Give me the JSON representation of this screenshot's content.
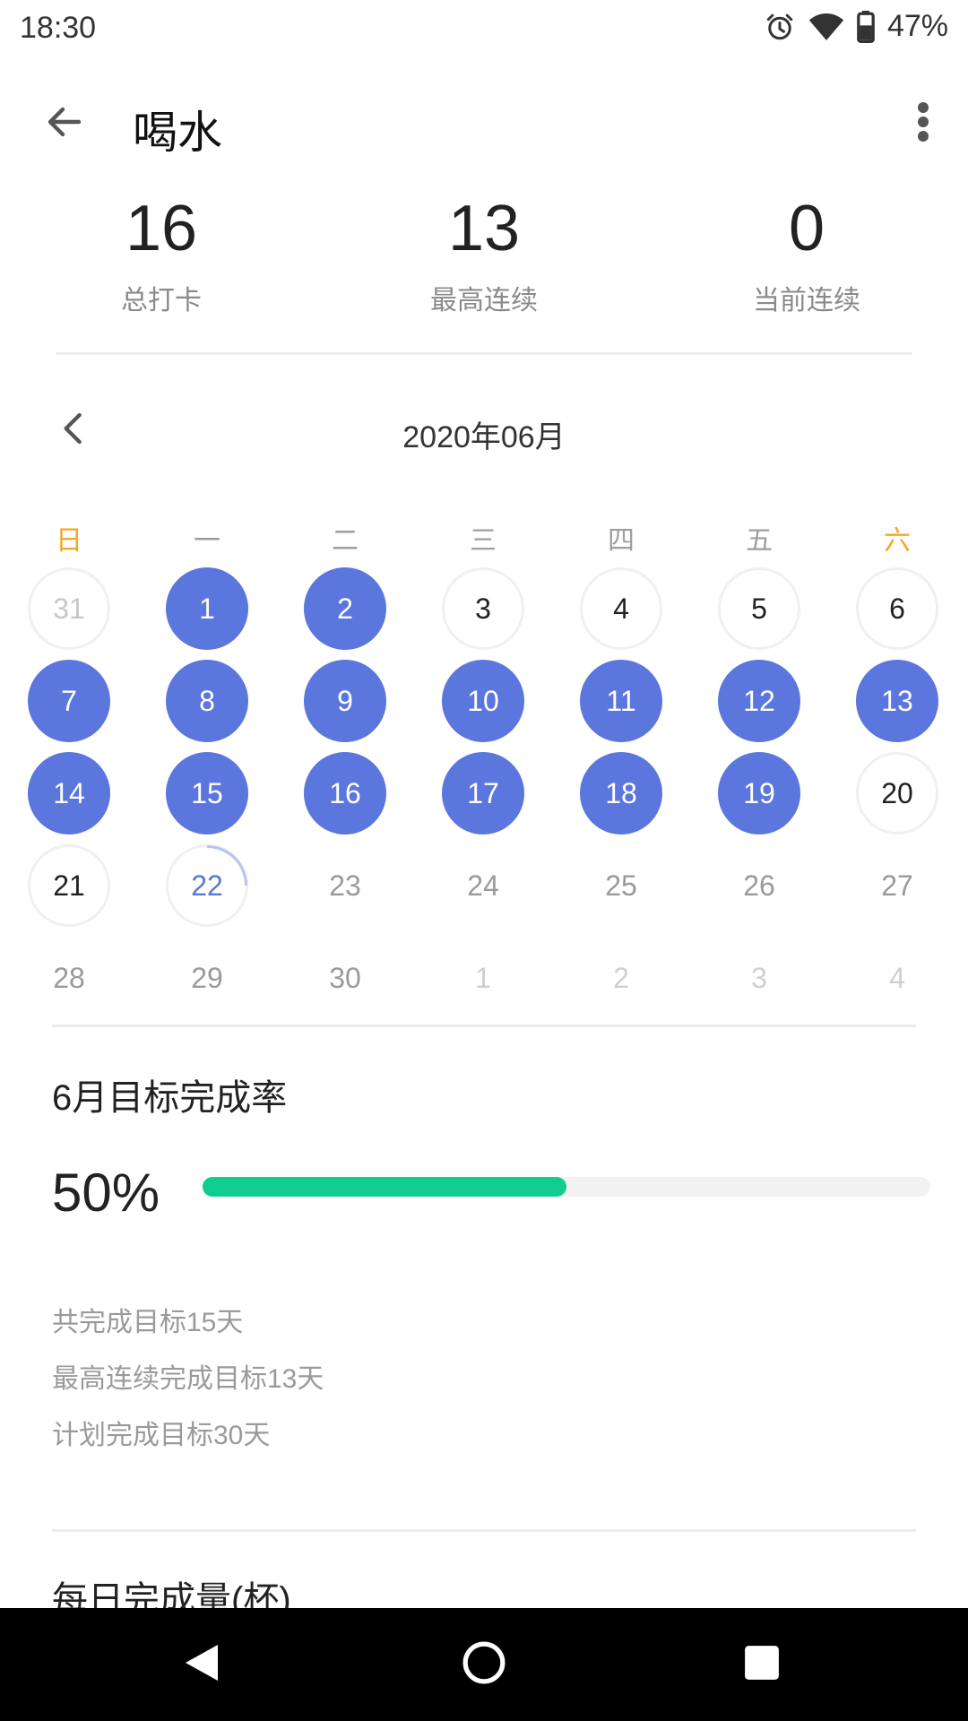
{
  "status_bar": {
    "time": "18:30",
    "battery": "47%",
    "icons": [
      "alarm-icon",
      "wifi-icon",
      "battery-icon"
    ]
  },
  "app_bar": {
    "title": "喝水",
    "back_icon": "arrow-left-icon",
    "more_icon": "more-vertical-icon"
  },
  "stats": [
    {
      "value": "16",
      "label": "总打卡"
    },
    {
      "value": "13",
      "label": "最高连续"
    },
    {
      "value": "0",
      "label": "当前连续"
    }
  ],
  "calendar": {
    "title": "2020年06月",
    "weekdays": [
      "日",
      "一",
      "二",
      "三",
      "四",
      "五",
      "六"
    ],
    "weeks": [
      [
        {
          "d": "31",
          "s": "prev"
        },
        {
          "d": "1",
          "s": "done"
        },
        {
          "d": "2",
          "s": "done"
        },
        {
          "d": "3",
          "s": "open"
        },
        {
          "d": "4",
          "s": "open"
        },
        {
          "d": "5",
          "s": "open"
        },
        {
          "d": "6",
          "s": "open"
        }
      ],
      [
        {
          "d": "7",
          "s": "done"
        },
        {
          "d": "8",
          "s": "done"
        },
        {
          "d": "9",
          "s": "done"
        },
        {
          "d": "10",
          "s": "done"
        },
        {
          "d": "11",
          "s": "done"
        },
        {
          "d": "12",
          "s": "done"
        },
        {
          "d": "13",
          "s": "done"
        }
      ],
      [
        {
          "d": "14",
          "s": "done"
        },
        {
          "d": "15",
          "s": "done"
        },
        {
          "d": "16",
          "s": "done"
        },
        {
          "d": "17",
          "s": "done"
        },
        {
          "d": "18",
          "s": "done"
        },
        {
          "d": "19",
          "s": "done"
        },
        {
          "d": "20",
          "s": "open"
        }
      ],
      [
        {
          "d": "21",
          "s": "open"
        },
        {
          "d": "22",
          "s": "today"
        },
        {
          "d": "23",
          "s": "future"
        },
        {
          "d": "24",
          "s": "future"
        },
        {
          "d": "25",
          "s": "future"
        },
        {
          "d": "26",
          "s": "future"
        },
        {
          "d": "27",
          "s": "future"
        }
      ],
      [
        {
          "d": "28",
          "s": "future"
        },
        {
          "d": "29",
          "s": "future"
        },
        {
          "d": "30",
          "s": "future"
        },
        {
          "d": "1",
          "s": "next"
        },
        {
          "d": "2",
          "s": "next"
        },
        {
          "d": "3",
          "s": "next"
        },
        {
          "d": "4",
          "s": "next"
        }
      ]
    ]
  },
  "goal": {
    "title": "6月目标完成率",
    "percent": "50%",
    "progress_fraction": 0.5,
    "lines": [
      "共完成目标15天",
      "最高连续完成目标13天",
      "计划完成目标30天"
    ]
  },
  "next_section_title": "每日完成量(杯)",
  "colors": {
    "accent": "#5b76dd",
    "progress": "#10cd8f",
    "weekend": "#f5a623"
  }
}
